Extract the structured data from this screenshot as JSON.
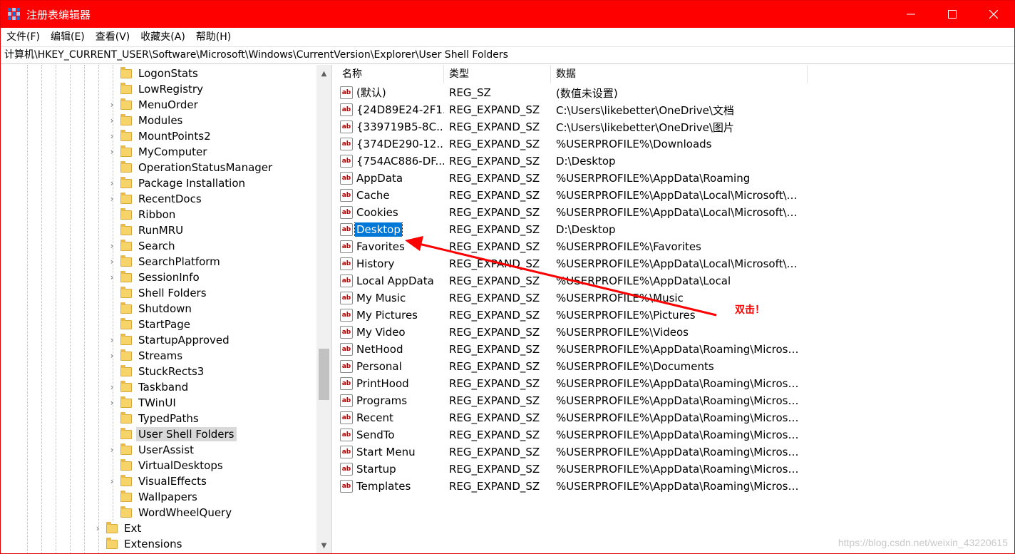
{
  "window": {
    "title": "注册表编辑器",
    "accent": "#ff0000",
    "controls": [
      "minimize-icon",
      "maximize-icon",
      "close-icon"
    ]
  },
  "menu": [
    "文件(F)",
    "编辑(E)",
    "查看(V)",
    "收藏夹(A)",
    "帮助(H)"
  ],
  "address": "计算机\\HKEY_CURRENT_USER\\Software\\Microsoft\\Windows\\CurrentVersion\\Explorer\\User Shell Folders",
  "tree": {
    "items": [
      {
        "label": "LogonStats",
        "expandable": false,
        "level": 1,
        "selected": false
      },
      {
        "label": "LowRegistry",
        "expandable": false,
        "level": 1,
        "selected": false
      },
      {
        "label": "MenuOrder",
        "expandable": true,
        "level": 1,
        "selected": false
      },
      {
        "label": "Modules",
        "expandable": true,
        "level": 1,
        "selected": false
      },
      {
        "label": "MountPoints2",
        "expandable": true,
        "level": 1,
        "selected": false
      },
      {
        "label": "MyComputer",
        "expandable": true,
        "level": 1,
        "selected": false
      },
      {
        "label": "OperationStatusManager",
        "expandable": false,
        "level": 1,
        "selected": false
      },
      {
        "label": "Package Installation",
        "expandable": true,
        "level": 1,
        "selected": false
      },
      {
        "label": "RecentDocs",
        "expandable": true,
        "level": 1,
        "selected": false
      },
      {
        "label": "Ribbon",
        "expandable": false,
        "level": 1,
        "selected": false
      },
      {
        "label": "RunMRU",
        "expandable": false,
        "level": 1,
        "selected": false
      },
      {
        "label": "Search",
        "expandable": true,
        "level": 1,
        "selected": false
      },
      {
        "label": "SearchPlatform",
        "expandable": true,
        "level": 1,
        "selected": false
      },
      {
        "label": "SessionInfo",
        "expandable": true,
        "level": 1,
        "selected": false
      },
      {
        "label": "Shell Folders",
        "expandable": false,
        "level": 1,
        "selected": false
      },
      {
        "label": "Shutdown",
        "expandable": false,
        "level": 1,
        "selected": false
      },
      {
        "label": "StartPage",
        "expandable": false,
        "level": 1,
        "selected": false
      },
      {
        "label": "StartupApproved",
        "expandable": true,
        "level": 1,
        "selected": false
      },
      {
        "label": "Streams",
        "expandable": true,
        "level": 1,
        "selected": false
      },
      {
        "label": "StuckRects3",
        "expandable": false,
        "level": 1,
        "selected": false
      },
      {
        "label": "Taskband",
        "expandable": true,
        "level": 1,
        "selected": false
      },
      {
        "label": "TWinUI",
        "expandable": true,
        "level": 1,
        "selected": false
      },
      {
        "label": "TypedPaths",
        "expandable": false,
        "level": 1,
        "selected": false
      },
      {
        "label": "User Shell Folders",
        "expandable": false,
        "level": 1,
        "selected": true
      },
      {
        "label": "UserAssist",
        "expandable": true,
        "level": 1,
        "selected": false
      },
      {
        "label": "VirtualDesktops",
        "expandable": false,
        "level": 1,
        "selected": false
      },
      {
        "label": "VisualEffects",
        "expandable": true,
        "level": 1,
        "selected": false
      },
      {
        "label": "Wallpapers",
        "expandable": false,
        "level": 1,
        "selected": false
      },
      {
        "label": "WordWheelQuery",
        "expandable": false,
        "level": 1,
        "selected": false
      },
      {
        "label": "Ext",
        "expandable": true,
        "level": 0,
        "selected": false
      },
      {
        "label": "Extensions",
        "expandable": false,
        "level": 0,
        "selected": false
      }
    ]
  },
  "list": {
    "columns": [
      "名称",
      "类型",
      "数据"
    ],
    "rows": [
      {
        "name": "(默认)",
        "type": "REG_SZ",
        "data": "(数值未设置)",
        "selected": false
      },
      {
        "name": "{24D89E24-2F1...",
        "type": "REG_EXPAND_SZ",
        "data": "C:\\Users\\likebetter\\OneDrive\\文档",
        "selected": false
      },
      {
        "name": "{339719B5-8C...",
        "type": "REG_EXPAND_SZ",
        "data": "C:\\Users\\likebetter\\OneDrive\\图片",
        "selected": false
      },
      {
        "name": "{374DE290-12...",
        "type": "REG_EXPAND_SZ",
        "data": "%USERPROFILE%\\Downloads",
        "selected": false
      },
      {
        "name": "{754AC886-DF...",
        "type": "REG_EXPAND_SZ",
        "data": "D:\\Desktop",
        "selected": false
      },
      {
        "name": "AppData",
        "type": "REG_EXPAND_SZ",
        "data": "%USERPROFILE%\\AppData\\Roaming",
        "selected": false
      },
      {
        "name": "Cache",
        "type": "REG_EXPAND_SZ",
        "data": "%USERPROFILE%\\AppData\\Local\\Microsoft\\W...",
        "selected": false
      },
      {
        "name": "Cookies",
        "type": "REG_EXPAND_SZ",
        "data": "%USERPROFILE%\\AppData\\Local\\Microsoft\\W...",
        "selected": false
      },
      {
        "name": "Desktop",
        "type": "REG_EXPAND_SZ",
        "data": "D:\\Desktop",
        "selected": true
      },
      {
        "name": "Favorites",
        "type": "REG_EXPAND_SZ",
        "data": "%USERPROFILE%\\Favorites",
        "selected": false
      },
      {
        "name": "History",
        "type": "REG_EXPAND_SZ",
        "data": "%USERPROFILE%\\AppData\\Local\\Microsoft\\W...",
        "selected": false
      },
      {
        "name": "Local AppData",
        "type": "REG_EXPAND_SZ",
        "data": "%USERPROFILE%\\AppData\\Local",
        "selected": false
      },
      {
        "name": "My Music",
        "type": "REG_EXPAND_SZ",
        "data": "%USERPROFILE%\\Music",
        "selected": false
      },
      {
        "name": "My Pictures",
        "type": "REG_EXPAND_SZ",
        "data": "%USERPROFILE%\\Pictures",
        "selected": false
      },
      {
        "name": "My Video",
        "type": "REG_EXPAND_SZ",
        "data": "%USERPROFILE%\\Videos",
        "selected": false
      },
      {
        "name": "NetHood",
        "type": "REG_EXPAND_SZ",
        "data": "%USERPROFILE%\\AppData\\Roaming\\Microsof...",
        "selected": false
      },
      {
        "name": "Personal",
        "type": "REG_EXPAND_SZ",
        "data": "%USERPROFILE%\\Documents",
        "selected": false
      },
      {
        "name": "PrintHood",
        "type": "REG_EXPAND_SZ",
        "data": "%USERPROFILE%\\AppData\\Roaming\\Microsof...",
        "selected": false
      },
      {
        "name": "Programs",
        "type": "REG_EXPAND_SZ",
        "data": "%USERPROFILE%\\AppData\\Roaming\\Microsof...",
        "selected": false
      },
      {
        "name": "Recent",
        "type": "REG_EXPAND_SZ",
        "data": "%USERPROFILE%\\AppData\\Roaming\\Microsof...",
        "selected": false
      },
      {
        "name": "SendTo",
        "type": "REG_EXPAND_SZ",
        "data": "%USERPROFILE%\\AppData\\Roaming\\Microsof...",
        "selected": false
      },
      {
        "name": "Start Menu",
        "type": "REG_EXPAND_SZ",
        "data": "%USERPROFILE%\\AppData\\Roaming\\Microsof...",
        "selected": false
      },
      {
        "name": "Startup",
        "type": "REG_EXPAND_SZ",
        "data": "%USERPROFILE%\\AppData\\Roaming\\Microsof...",
        "selected": false
      },
      {
        "name": "Templates",
        "type": "REG_EXPAND_SZ",
        "data": "%USERPROFILE%\\AppData\\Roaming\\Microsof...",
        "selected": false
      }
    ]
  },
  "annotation": {
    "text": "双击！",
    "color": "#ff0000"
  },
  "watermark": "https://blog.csdn.net/weixin_43220615",
  "icons": {
    "value_icon": "ab-string-icon",
    "tree_icon": "folder-icon"
  }
}
